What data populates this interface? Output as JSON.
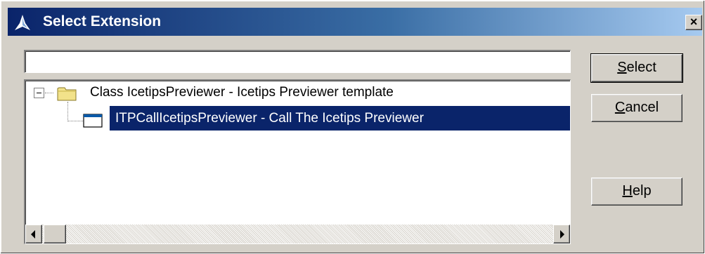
{
  "window": {
    "title": "Select Extension",
    "close_label": "×"
  },
  "filter": {
    "value": "",
    "placeholder": ""
  },
  "tree": {
    "root": {
      "label": "Class IcetipsPreviewer - Icetips Previewer template",
      "expanded": true,
      "icon": "folder-icon"
    },
    "children": [
      {
        "label": "ITPCallIcetipsPreviewer - Call The Icetips Previewer",
        "selected": true,
        "icon": "window-icon"
      }
    ]
  },
  "buttons": {
    "select": {
      "mnemonic": "S",
      "rest": "elect"
    },
    "cancel": {
      "mnemonic": "C",
      "rest": "ancel"
    },
    "help": {
      "mnemonic": "H",
      "rest": "elp"
    }
  },
  "colors": {
    "selection": "#0a246a",
    "titlebar_start": "#0a246a",
    "titlebar_end": "#a6caf0",
    "face": "#d4d0c8"
  }
}
